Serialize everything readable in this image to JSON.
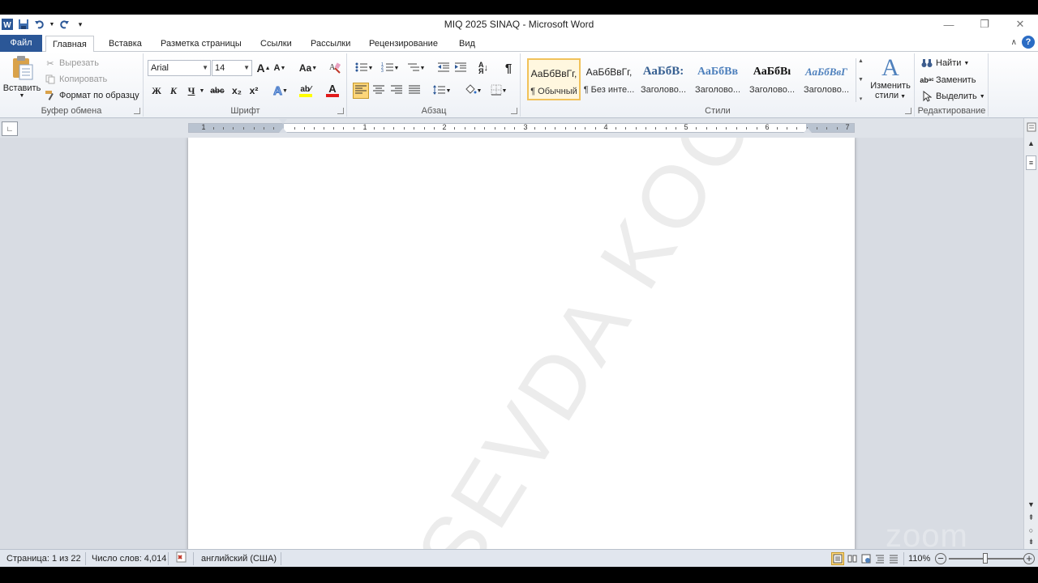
{
  "window": {
    "title": "MIQ 2025 SINAQ  -  Microsoft Word",
    "controls": {
      "minimize": "—",
      "restore": "❐",
      "close": "✕"
    }
  },
  "ribbon_tabs": {
    "file": "Файл",
    "home": "Главная",
    "insert": "Вставка",
    "page_layout": "Разметка страницы",
    "references": "Ссылки",
    "mailings": "Рассылки",
    "review": "Рецензирование",
    "view": "Вид"
  },
  "clipboard": {
    "paste": "Вставить",
    "cut": "Вырезать",
    "copy": "Копировать",
    "format_painter": "Формат по образцу",
    "label": "Буфер обмена"
  },
  "font": {
    "name": "Arial",
    "size": "14",
    "label": "Шрифт",
    "bold": "Ж",
    "italic": "К",
    "underline": "Ч",
    "strike": "abc",
    "subscript": "x₂",
    "superscript": "x²",
    "grow": "A",
    "shrink": "A",
    "change_case": "Aa",
    "font_color": "A"
  },
  "paragraph": {
    "label": "Абзац",
    "show_marks": "¶"
  },
  "styles": {
    "label": "Стили",
    "items": [
      {
        "sample": "АаБбВвГг,",
        "name": "¶ Обычный"
      },
      {
        "sample": "АаБбВвГг,",
        "name": "¶ Без инте..."
      },
      {
        "sample": "АаБбВ:",
        "name": "Заголово..."
      },
      {
        "sample": "АаБбВв",
        "name": "Заголово..."
      },
      {
        "sample": "АаБбВı",
        "name": "Заголово..."
      },
      {
        "sample": "АаБбВвГ",
        "name": "Заголово..."
      }
    ],
    "change_styles_line1": "Изменить",
    "change_styles_line2": "стили"
  },
  "editing": {
    "label": "Редактирование",
    "find": "Найти",
    "replace": "Заменить",
    "select": "Выделить"
  },
  "ruler": {
    "numbers": [
      "1",
      "1",
      "2",
      "3",
      "4",
      "5",
      "6",
      "7"
    ]
  },
  "document": {
    "watermark": "SEVDA KOCH"
  },
  "overlay": {
    "zoom_logo": "zoom"
  },
  "status": {
    "page": "Страница: 1 из 22",
    "words": "Число слов: 4,014",
    "language": "английский (США)",
    "zoom": "110%"
  },
  "colors": {
    "file_tab": "#2b5797",
    "active_highlight": "#fcd67a",
    "font_color_bar": "#e21b1b",
    "highlight_bar": "#ffff00",
    "workspace": "#d8dce3"
  }
}
